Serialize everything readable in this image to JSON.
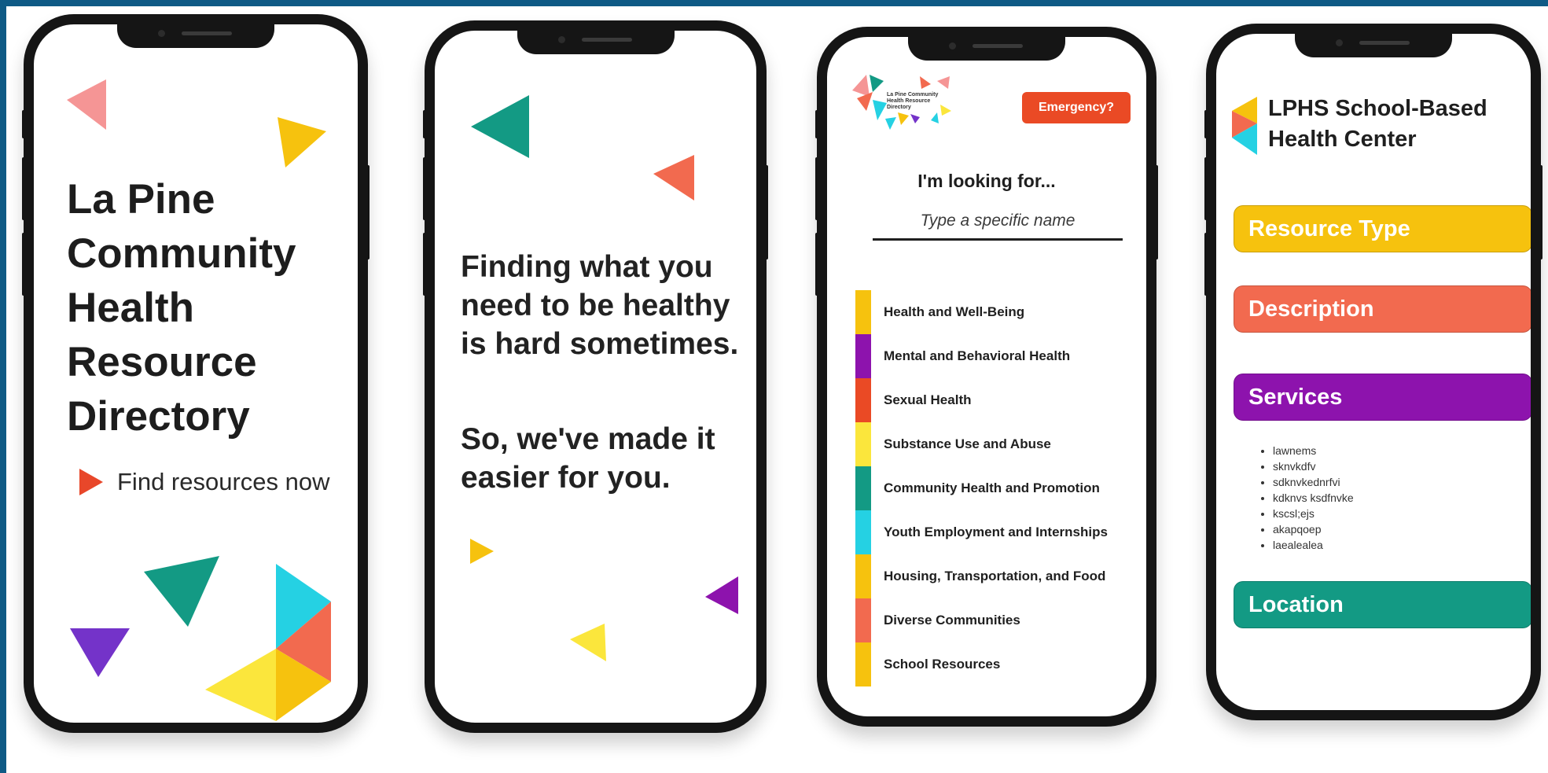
{
  "colors": {
    "frame": "#0f5a85",
    "yellow": "#f6c20e",
    "purple": "#8d13ad",
    "red": "#ea4a25",
    "lemon": "#fbe63c",
    "teal": "#139a84",
    "cyan": "#25d1e3",
    "salmon": "#f26a4f",
    "pink": "#f59595",
    "violet": "#7433c9"
  },
  "screen1": {
    "title": "La Pine Community Health Resource Directory",
    "cta_label": "Find resources now"
  },
  "screen2": {
    "line1": "Finding what you need to be healthy is hard sometimes.",
    "line2": "So, we've made it easier for you."
  },
  "screen3": {
    "logo_text": "La Pine Community Health Resource Directory",
    "emergency_label": "Emergency?",
    "search_label": "I'm looking for...",
    "search_placeholder": "Type a specific name",
    "categories": [
      {
        "label": "Health and Well-Being",
        "color": "#f6c20e"
      },
      {
        "label": "Mental and Behavioral Health",
        "color": "#8d13ad"
      },
      {
        "label": "Sexual Health",
        "color": "#ea4a25"
      },
      {
        "label": "Substance Use and Abuse",
        "color": "#fbe63c"
      },
      {
        "label": "Community Health and Promotion",
        "color": "#139a84"
      },
      {
        "label": "Youth Employment and Internships",
        "color": "#25d1e3"
      },
      {
        "label": "Housing, Transportation, and Food",
        "color": "#f6c20e"
      },
      {
        "label": "Diverse Communities",
        "color": "#f26a4f"
      },
      {
        "label": "School Resources",
        "color": "#f6c20e"
      }
    ]
  },
  "screen4": {
    "title": "LPHS School-Based Health Center",
    "sections": {
      "resource_type": "Resource Type",
      "description": "Description",
      "services": "Services",
      "location": "Location"
    },
    "services_list": [
      "lawnems",
      "sknvkdfv",
      "sdknvkednrfvi",
      "kdknvs ksdfnvke",
      "kscsl;ejs",
      "akapqoep",
      "laealealea"
    ]
  }
}
